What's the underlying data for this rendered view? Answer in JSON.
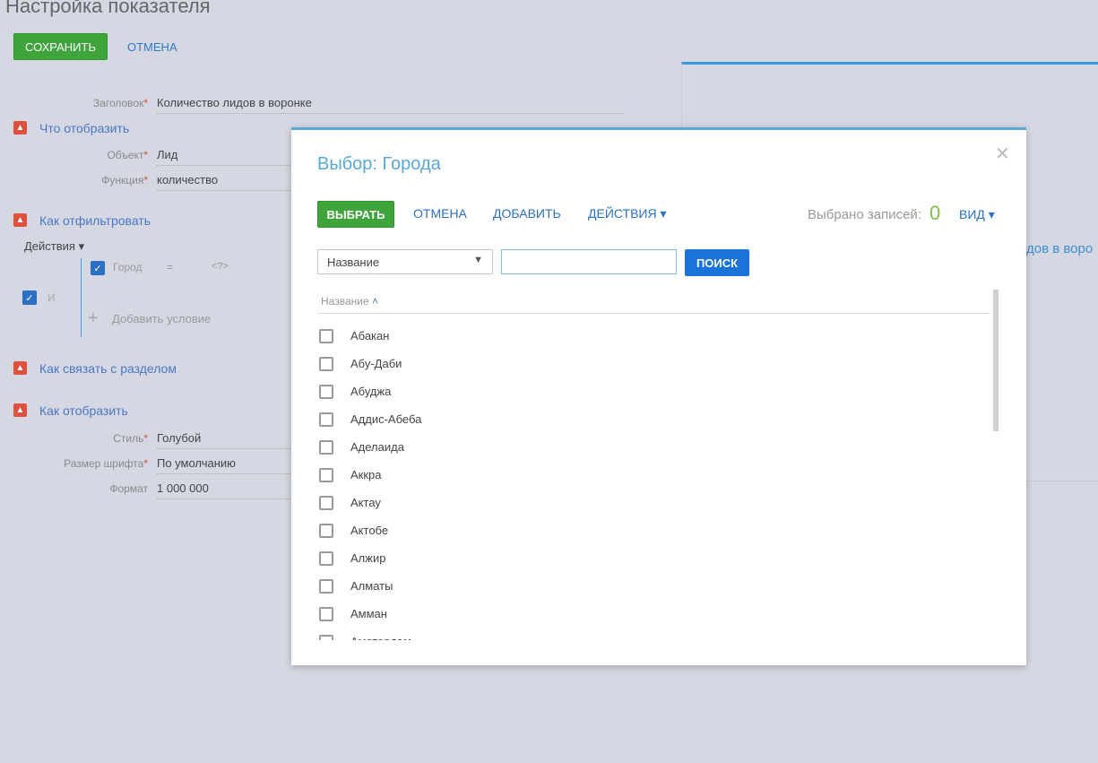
{
  "page": {
    "title": "Настройка показателя",
    "save": "СОХРАНИТЬ",
    "cancel": "ОТМЕНА"
  },
  "form": {
    "caption_label": "Заголовок",
    "caption_value": "Количество лидов в воронке",
    "section_what": "Что отобразить",
    "object_label": "Объект",
    "object_value": "Лид",
    "function_label": "Функция",
    "function_value": "количество",
    "section_filter": "Как отфильтровать",
    "actions": "Действия",
    "group_op": "И",
    "cond_field": "Город",
    "cond_op": "=",
    "cond_value": "<?>",
    "add_condition": "Добавить условие",
    "section_link": "Как связать с разделом",
    "section_display": "Как отобразить",
    "style_label": "Стиль",
    "style_value": "Голубой",
    "fontsize_label": "Размер шрифта",
    "fontsize_value": "По умолчанию",
    "format_label": "Формат",
    "format_value": "1 000 000",
    "required_mark": "*"
  },
  "preview": {
    "text": "дов в воро"
  },
  "modal": {
    "title": "Выбор: Города",
    "select": "ВЫБРАТЬ",
    "cancel": "ОТМЕНА",
    "add": "ДОБАВИТЬ",
    "actions": "ДЕЙСТВИЯ",
    "selected_label": "Выбрано записей:",
    "selected_count": "0",
    "view": "ВИД",
    "search_field": "Название",
    "search_value": "",
    "search_button": "ПОИСК",
    "column": "Название",
    "rows": [
      "Абакан",
      "Абу-Даби",
      "Абуджа",
      "Аддис-Абеба",
      "Аделаида",
      "Аккра",
      "Актау",
      "Актобе",
      "Алжир",
      "Алматы",
      "Амман",
      "Амстердам"
    ]
  },
  "colors": {
    "accent": "#3b9ad8",
    "save": "#3fa43b",
    "count": "#7cc242"
  }
}
